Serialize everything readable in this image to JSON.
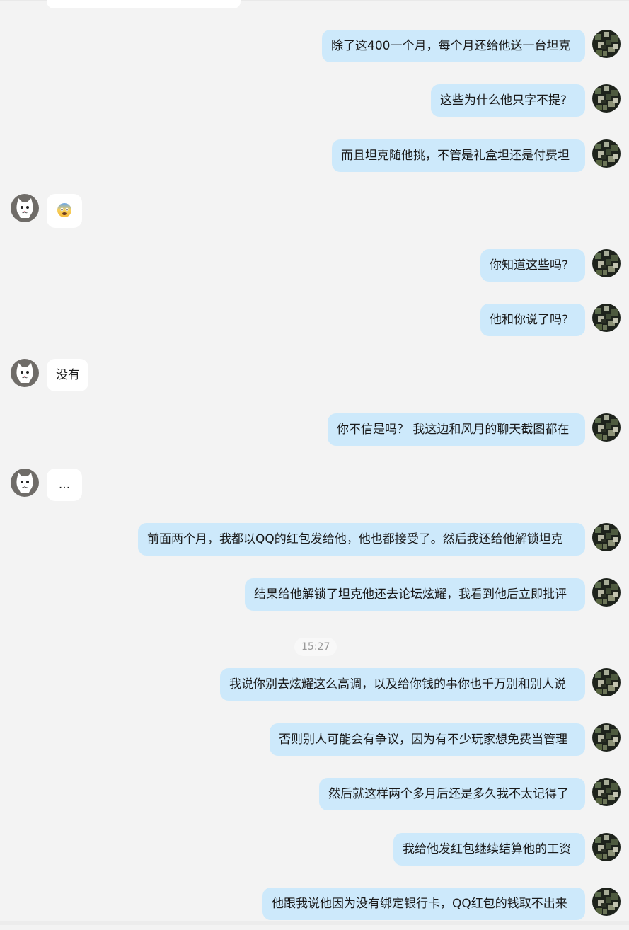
{
  "messages": [
    {
      "dir": "out",
      "text": "除了这400一个月，每个月还给他送一台坦克"
    },
    {
      "dir": "out",
      "text": "这些为什么他只字不提?"
    },
    {
      "dir": "out",
      "text": "而且坦克随他挑，不管是礼盒坦还是付费坦"
    },
    {
      "dir": "in",
      "text": "",
      "emoji": "fearful-face-emoji"
    },
    {
      "dir": "out",
      "text": "你知道这些吗?"
    },
    {
      "dir": "out",
      "text": "他和你说了吗?"
    },
    {
      "dir": "in",
      "text": "没有"
    },
    {
      "dir": "out",
      "text": "你不信是吗？ 我这边和风月的聊天截图都在"
    },
    {
      "dir": "in",
      "text": "..."
    },
    {
      "dir": "out",
      "text": "前面两个月，我都以QQ的红包发给他，他也都接受了。然后我还给他解锁坦克"
    },
    {
      "dir": "out",
      "text": "结果给他解锁了坦克他还去论坛炫耀，我看到他后立即批评"
    },
    {
      "dir": "out",
      "text": "我说你别去炫耀这么高调，以及给你钱的事你也千万别和别人说"
    },
    {
      "dir": "out",
      "text": "否则别人可能会有争议，因为有不少玩家想免费当管理"
    },
    {
      "dir": "out",
      "text": "然后就这样两个多月后还是多久我不太记得了"
    },
    {
      "dir": "out",
      "text": "我给他发红包继续结算他的工资"
    },
    {
      "dir": "out",
      "text": "他跟我说他因为没有绑定银行卡，QQ红包的钱取不出来"
    }
  ],
  "timestamp": "15:27",
  "colors": {
    "background": "#f3f3f3",
    "outgoing_bubble": "#cde9fb",
    "incoming_bubble": "#ffffff",
    "timestamp_text": "#999999"
  },
  "icons": {
    "outgoing_avatar": "camouflage-avatar-icon",
    "incoming_avatar": "white-cat-avatar-icon"
  }
}
